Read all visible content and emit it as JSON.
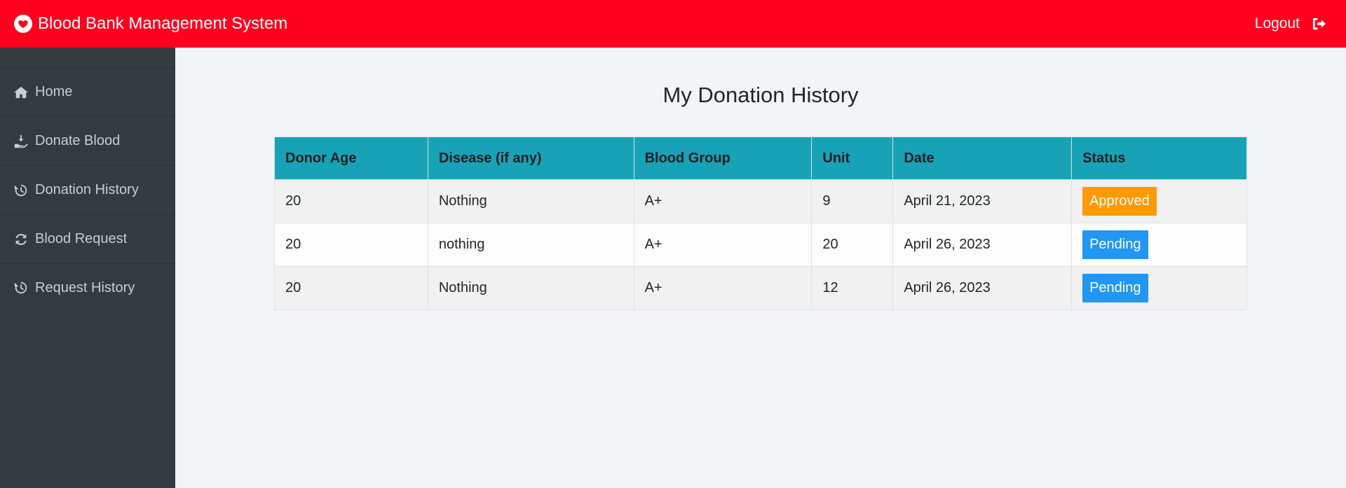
{
  "header": {
    "brand_title": "Blood Bank Management System",
    "logout_label": "Logout",
    "bg_color": "#ff001e"
  },
  "sidebar": {
    "items": [
      {
        "label": "Home",
        "icon": "home-icon"
      },
      {
        "label": "Donate Blood",
        "icon": "donate-icon"
      },
      {
        "label": "Donation History",
        "icon": "history-icon"
      },
      {
        "label": "Blood Request",
        "icon": "refresh-icon"
      },
      {
        "label": "Request History",
        "icon": "history-icon"
      }
    ]
  },
  "main": {
    "title": "My Donation History",
    "table": {
      "headers": [
        "Donor Age",
        "Disease (if any)",
        "Blood Group",
        "Unit",
        "Date",
        "Status"
      ],
      "rows": [
        [
          "20",
          "Nothing",
          "A+",
          "9",
          "April 21, 2023",
          "Approved"
        ],
        [
          "20",
          "nothing",
          "A+",
          "20",
          "April 26, 2023",
          "Pending"
        ],
        [
          "20",
          "Nothing",
          "A+",
          "12",
          "April 26, 2023",
          "Pending"
        ]
      ]
    },
    "status_colors": {
      "Approved": "#ff9a00",
      "Pending": "#2196f3"
    },
    "header_color": "#17a2b8"
  }
}
